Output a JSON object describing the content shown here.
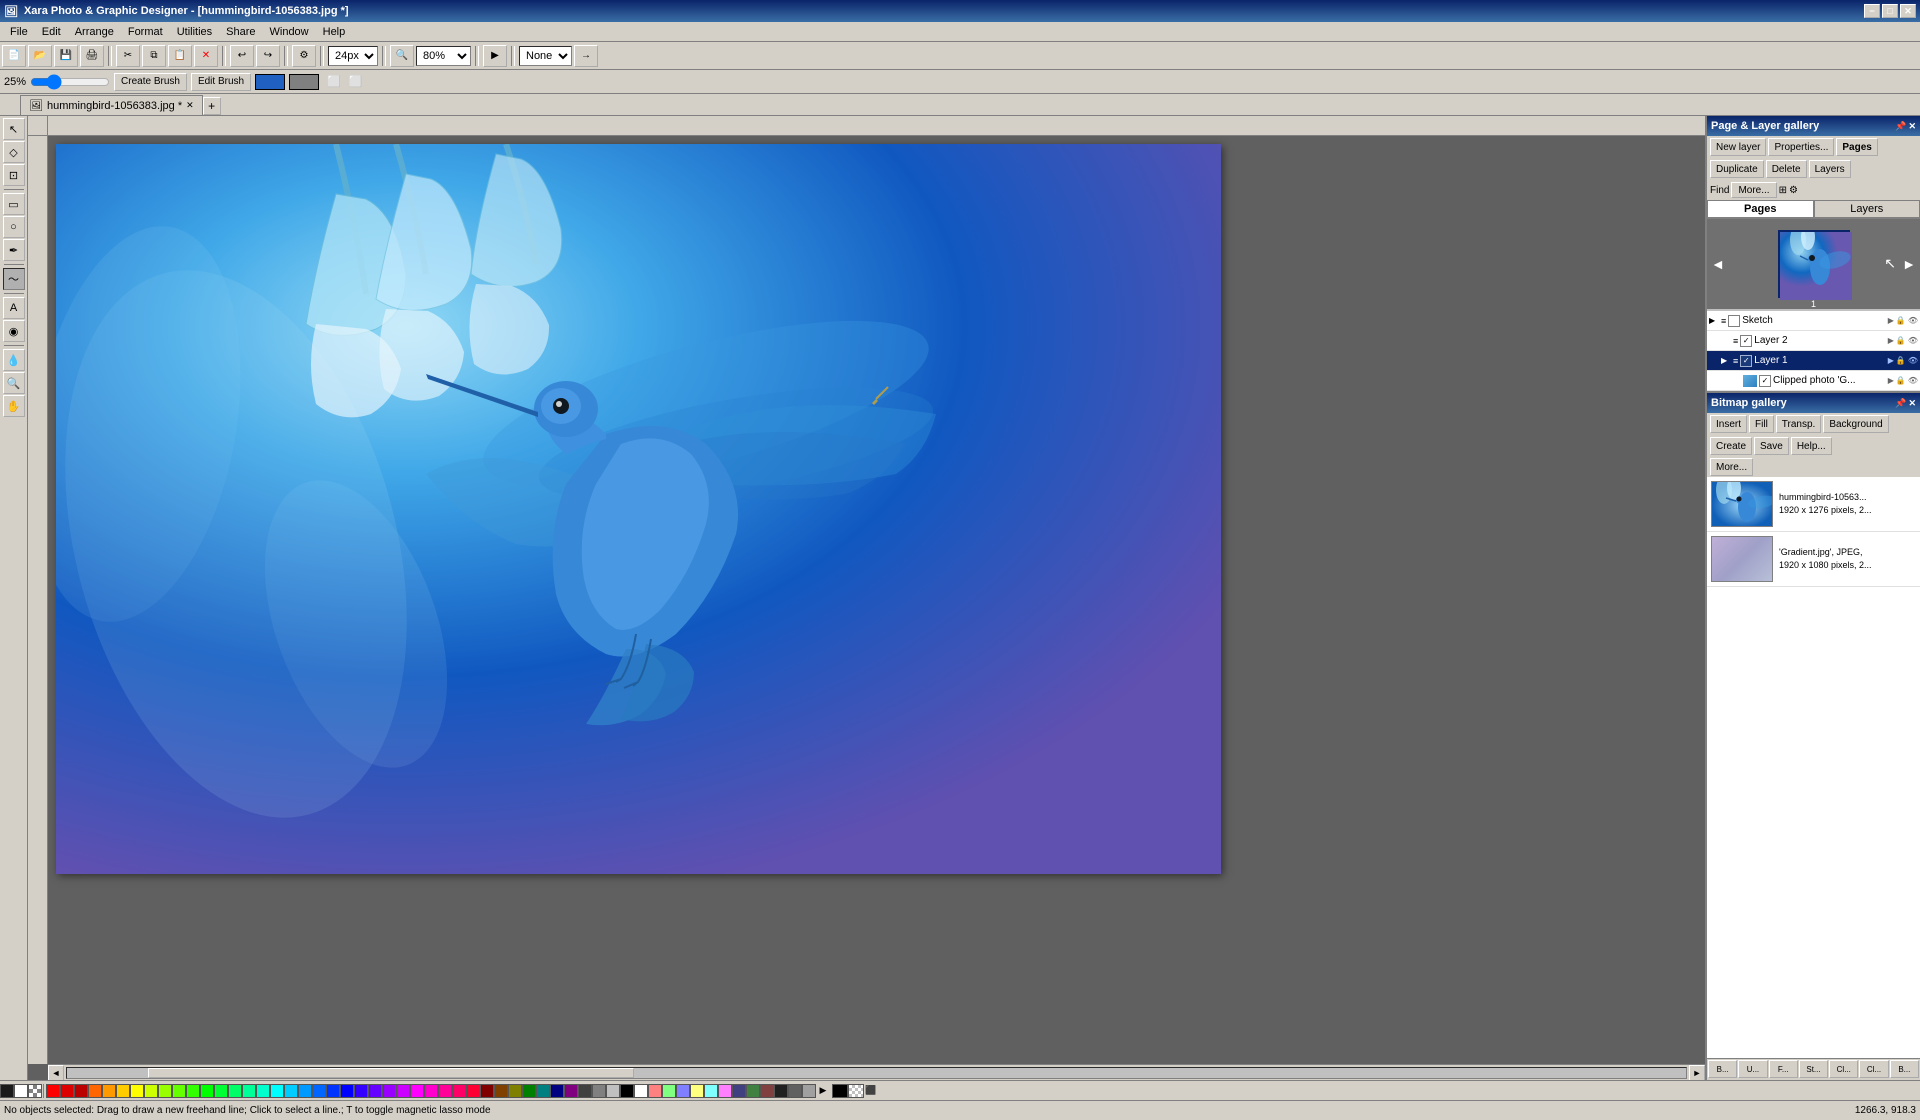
{
  "app": {
    "title": "Xara Photo & Graphic Designer - [hummingbird-1056383.jpg *]",
    "icon": "🖼"
  },
  "title_bar": {
    "title": "Xara Photo & Graphic Designer - [hummingbird-1056383.jpg *]",
    "min_label": "−",
    "max_label": "□",
    "close_label": "✕"
  },
  "menu": {
    "items": [
      "File",
      "Edit",
      "Arrange",
      "Format",
      "Utilities",
      "Share",
      "Window",
      "Help"
    ]
  },
  "toolbar": {
    "zoom_value": "24px",
    "zoom_percent": "80%",
    "fit_label": "None",
    "nav_arrow": "→"
  },
  "brush_toolbar": {
    "size_value": "25%",
    "create_brush_label": "Create Brush",
    "edit_brush_label": "Edit Brush"
  },
  "tab": {
    "name": "hummingbird-1056383.jpg *",
    "close": "✕",
    "add": "+"
  },
  "tools": [
    {
      "name": "selector",
      "icon": "↖"
    },
    {
      "name": "node",
      "icon": "◇"
    },
    {
      "name": "contour",
      "icon": "⊡"
    },
    {
      "name": "text",
      "icon": "A"
    },
    {
      "name": "shape",
      "icon": "▭"
    },
    {
      "name": "pen",
      "icon": "✒"
    },
    {
      "name": "brush",
      "icon": "🖌"
    },
    {
      "name": "eraser",
      "icon": "⬜"
    },
    {
      "name": "fill",
      "icon": "◉"
    },
    {
      "name": "eyedrop",
      "icon": "💧"
    },
    {
      "name": "zoom",
      "icon": "🔍"
    },
    {
      "name": "push",
      "icon": "✋"
    },
    {
      "name": "freehand",
      "icon": "〜"
    }
  ],
  "page_layer_gallery": {
    "title": "Page & Layer gallery",
    "new_layer_label": "New layer",
    "properties_label": "Properties...",
    "pages_label": "Pages",
    "duplicate_label": "Duplicate",
    "delete_label": "Delete",
    "layers_label": "Layers",
    "find_label": "Find",
    "more_label": "More...",
    "pages_tab": "Pages",
    "layers_tab": "Layers",
    "page_number": "1",
    "layers": [
      {
        "name": "Sketch",
        "indent": 0,
        "selected": false,
        "has_children": true,
        "icon": "≡"
      },
      {
        "name": "Layer 2",
        "indent": 1,
        "selected": false,
        "has_children": false,
        "icon": "≡"
      },
      {
        "name": "Layer 1",
        "indent": 1,
        "selected": true,
        "has_children": true,
        "icon": "≡"
      },
      {
        "name": "Clipped photo 'G...",
        "indent": 2,
        "selected": false,
        "has_children": false,
        "icon": "▣"
      }
    ]
  },
  "bitmap_gallery": {
    "title": "Bitmap gallery",
    "insert_label": "Insert",
    "fill_label": "Fill",
    "transp_label": "Transp.",
    "background_label": "Background",
    "create_label": "Create",
    "save_label": "Save",
    "help_label": "Help...",
    "more_label": "More...",
    "items": [
      {
        "name": "hummingbird-10563...",
        "info": "1920 x 1276 pixels, 2...",
        "bg_color": "#1a90e0"
      },
      {
        "name": "'Gradient.jpg',  JPEG,",
        "info": "1920 x 1080 pixels, 2...",
        "bg_color": "#b0a0d0"
      }
    ]
  },
  "status_bar": {
    "message": "No objects selected:  Drag to draw a new freehand line; Click to select a line.; T to toggle magnetic lasso mode",
    "coordinates": "1266.3, 918.3",
    "coords_label": "1266.3, 918.3"
  },
  "palette": {
    "colors": [
      "#1a1a1a",
      "#ffffff",
      "#ff0000",
      "#cc0000",
      "#aa0000",
      "#ff6600",
      "#ff9900",
      "#ffcc00",
      "#ffff00",
      "#ccff00",
      "#99ff00",
      "#66ff00",
      "#33ff00",
      "#00ff00",
      "#00ff33",
      "#00ff66",
      "#00ff99",
      "#00ffcc",
      "#00ffff",
      "#00ccff",
      "#0099ff",
      "#0066ff",
      "#0033ff",
      "#0000ff",
      "#3300ff",
      "#6600ff",
      "#9900ff",
      "#cc00ff",
      "#ff00ff",
      "#ff00cc",
      "#ff0099",
      "#ff0066",
      "#ff0033",
      "#800000",
      "#804000",
      "#808000",
      "#008000",
      "#008080",
      "#000080",
      "#800080",
      "#404040",
      "#808080",
      "#c0c0c0",
      "#000000",
      "#ffffff",
      "#ff8080",
      "#80ff80",
      "#8080ff",
      "#ffff80",
      "#80ffff",
      "#ff80ff",
      "#404080",
      "#408040",
      "#804040",
      "#202020",
      "#606060",
      "#a0a0a0"
    ]
  },
  "right_panel_bottom_tabs": [
    "B...",
    "U...",
    "F...",
    "St...",
    "Cl...",
    "Cl...",
    "B..."
  ]
}
